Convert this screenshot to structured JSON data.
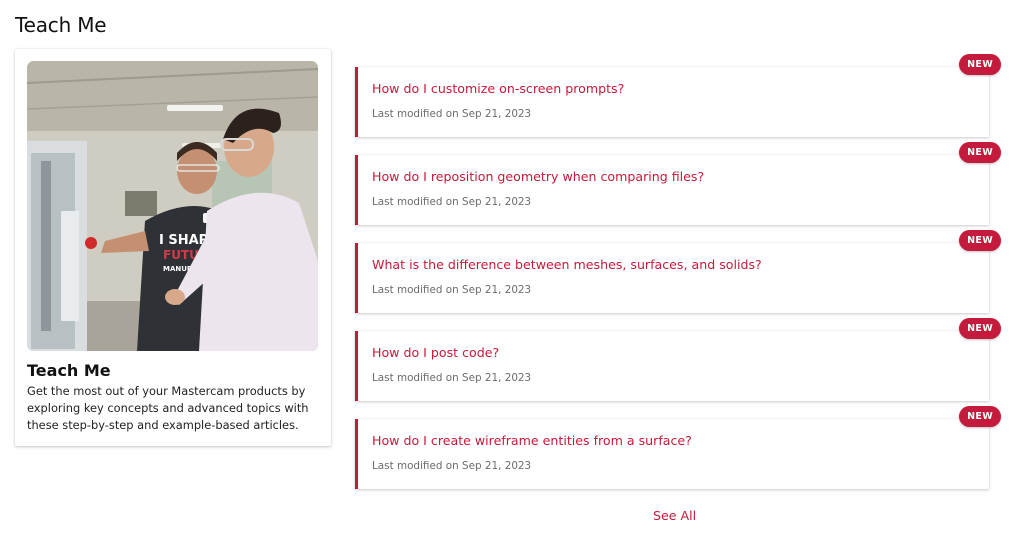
{
  "page": {
    "title": "Teach Me"
  },
  "feature": {
    "title": "Teach Me",
    "description": "Get the most out of your Mastercam products by exploring key concepts and advanced topics with these step-by-step and example-based articles.",
    "image": {
      "shirt_text_line1": "I SHAPE",
      "shirt_text_line2": "FUTURE",
      "shirt_text_line3": "MANUFACTUR"
    }
  },
  "articles": [
    {
      "title": "How do I customize on-screen prompts?",
      "meta": "Last modified on Sep 21, 2023",
      "badge": "NEW"
    },
    {
      "title": "How do I reposition geometry when comparing files?",
      "meta": "Last modified on Sep 21, 2023",
      "badge": "NEW"
    },
    {
      "title": "What is the difference between meshes, surfaces, and solids?",
      "meta": "Last modified on Sep 21, 2023",
      "badge": "NEW"
    },
    {
      "title": "How do I post code?",
      "meta": "Last modified on Sep 21, 2023",
      "badge": "NEW"
    },
    {
      "title": "How do I create wireframe entities from a surface?",
      "meta": "Last modified on Sep 21, 2023",
      "badge": "NEW"
    }
  ],
  "see_all": "See All",
  "colors": {
    "accent": "#c41a3b",
    "meta": "#6b6b6b"
  }
}
